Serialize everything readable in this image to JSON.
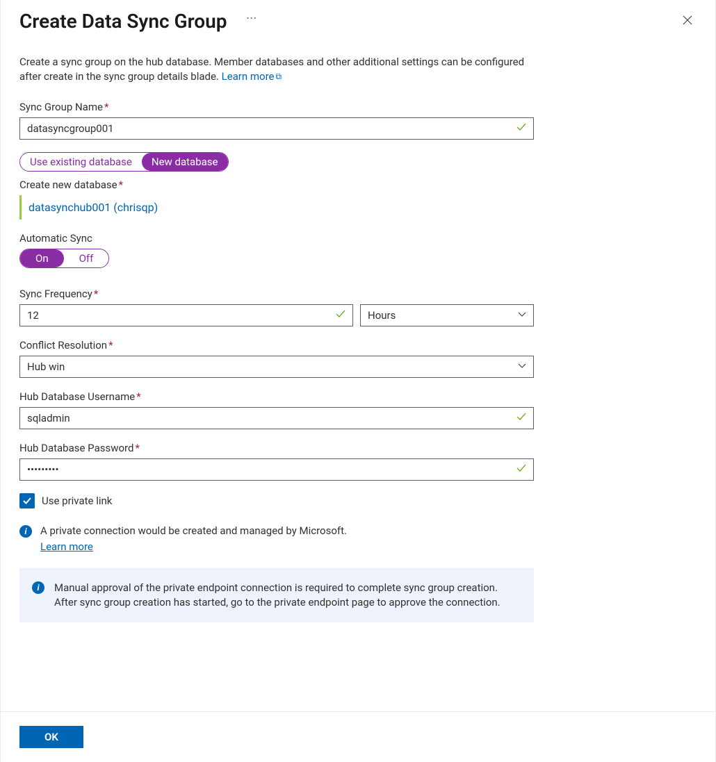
{
  "header": {
    "title": "Create Data Sync Group"
  },
  "intro": {
    "text": "Create a sync group on the hub database. Member databases and other additional settings can be configured after create in the sync group details blade. ",
    "learn_more": "Learn more"
  },
  "fields": {
    "sync_group_name": {
      "label": "Sync Group Name",
      "value": "datasyncgroup001"
    },
    "db_toggle": {
      "existing": "Use existing database",
      "new": "New database",
      "selected": "new"
    },
    "create_db": {
      "label": "Create new database",
      "link": "datasynchub001 (chrisqp)"
    },
    "auto_sync": {
      "label": "Automatic Sync",
      "on": "On",
      "off": "Off",
      "selected": "on"
    },
    "sync_freq": {
      "label": "Sync Frequency",
      "value": "12",
      "unit": "Hours"
    },
    "conflict": {
      "label": "Conflict Resolution",
      "value": "Hub win"
    },
    "hub_user": {
      "label": "Hub Database Username",
      "value": "sqladmin"
    },
    "hub_pass": {
      "label": "Hub Database Password",
      "value": "•••••••••"
    },
    "private_link": {
      "label": "Use private link",
      "checked": true
    }
  },
  "info1": {
    "text": "A private connection would be created and managed by Microsoft.",
    "learn": "Learn more"
  },
  "callout": {
    "text": "Manual approval of the private endpoint connection is required to complete sync group creation. After sync group creation has started, go to the private endpoint page to approve the connection."
  },
  "footer": {
    "ok": "OK"
  }
}
